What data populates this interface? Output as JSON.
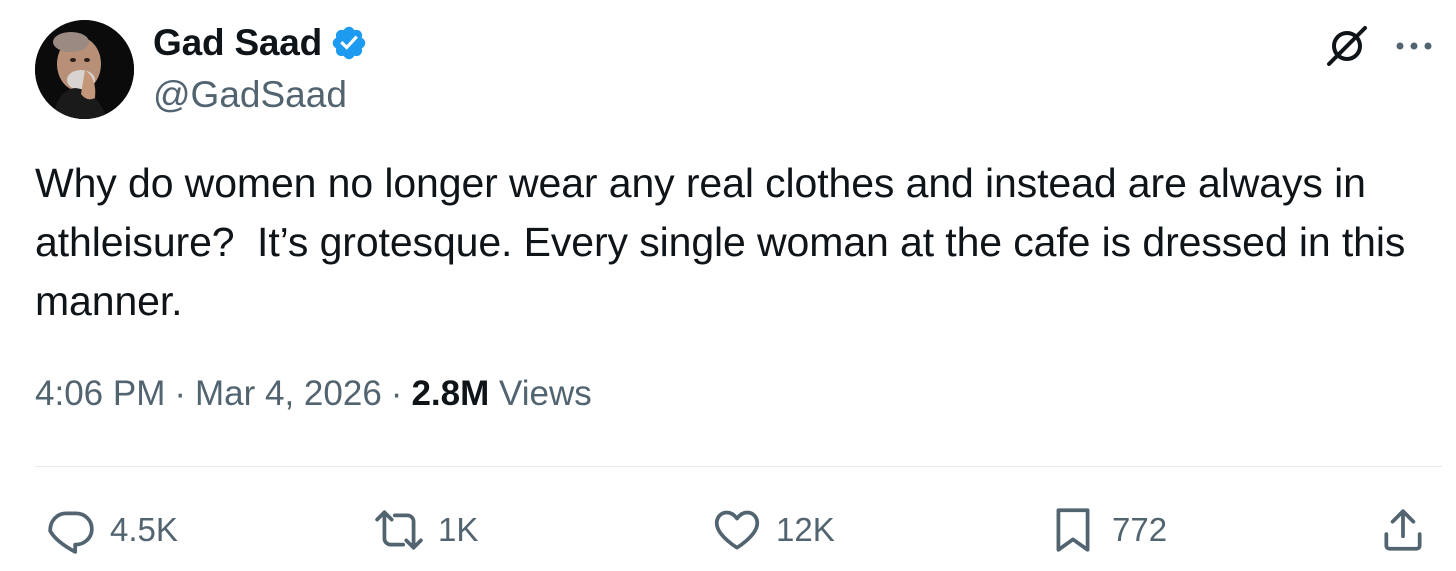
{
  "author": {
    "display_name": "Gad Saad",
    "handle": "@GadSaad",
    "verified": true
  },
  "icons": {
    "avatar": "profile-photo",
    "verified": "verified-badge-icon",
    "grok": "grok-icon",
    "more": "more-icon",
    "reply": "reply-icon",
    "repost": "repost-icon",
    "like": "heart-icon",
    "bookmark": "bookmark-icon",
    "share": "share-icon"
  },
  "colors": {
    "text_primary": "#0f1419",
    "text_secondary": "#536471",
    "verified_blue": "#1d9bf0",
    "divider": "#e7e9ea"
  },
  "tweet": {
    "text": "Why do women no longer wear any real clothes and instead are always in athleisure?  It’s grotesque. Every single woman at the cafe is dressed in this manner.",
    "time": "4:06 PM",
    "date": "Mar 4, 2026",
    "views_count": "2.8M",
    "views_label": "Views",
    "separator": "·"
  },
  "actions": {
    "replies": "4.5K",
    "reposts": "1K",
    "likes": "12K",
    "bookmarks": "772"
  }
}
